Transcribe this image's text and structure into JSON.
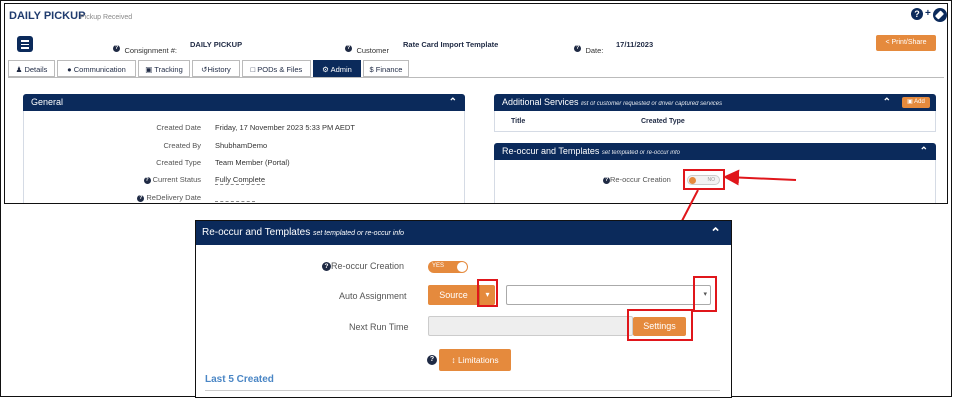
{
  "header": {
    "title": "DAILY PICKUP",
    "status": "Pickup Received",
    "consignment_label": "Consignment #:",
    "consignment_value": "DAILY PICKUP",
    "customer_label": "Customer",
    "customer_value": "Rate Card Import Template",
    "date_label": "Date:",
    "date_value": "17/11/2023",
    "print_share": "Print/Share"
  },
  "tabs": [
    {
      "label": "Details",
      "icon": "user-icon"
    },
    {
      "label": "Communication",
      "icon": "chat-icon"
    },
    {
      "label": "Tracking",
      "icon": "truck-icon"
    },
    {
      "label": "History",
      "icon": "history-icon"
    },
    {
      "label": "PODs & Files",
      "icon": "file-icon"
    },
    {
      "label": "Admin",
      "icon": "gear-icon"
    },
    {
      "label": "$ Finance",
      "icon": ""
    }
  ],
  "general": {
    "title": "General",
    "rows": [
      {
        "label": "Created Date",
        "value": "Friday, 17 November 2023 5:33 PM AEDT"
      },
      {
        "label": "Created By",
        "value": "ShubhamDemo"
      },
      {
        "label": "Created Type",
        "value": "Team Member (Portal)"
      },
      {
        "label": "Current Status",
        "value": "Fully Complete"
      },
      {
        "label": "ReDelivery Date",
        "value": ""
      }
    ]
  },
  "additional_services": {
    "title": "Additional Services",
    "subtitle": "list of customer requested or driver captured services",
    "add_label": "Add",
    "col_title": "Title",
    "col_created_type": "Created Type"
  },
  "reoccur": {
    "title": "Re-occur and Templates",
    "subtitle": "set templated or re-occur info",
    "creation_label": "Re-occur Creation",
    "toggle_off": "NO",
    "toggle_on": "YES",
    "auto_assignment_label": "Auto Assignment",
    "source_label": "Source",
    "next_run_label": "Next Run Time",
    "settings_label": "Settings",
    "limitations_label": "Limitations",
    "last5_label": "Last 5 Created"
  },
  "colors": {
    "navy": "#0b2a5b",
    "orange": "#e58a3d",
    "red": "#e0161b"
  }
}
